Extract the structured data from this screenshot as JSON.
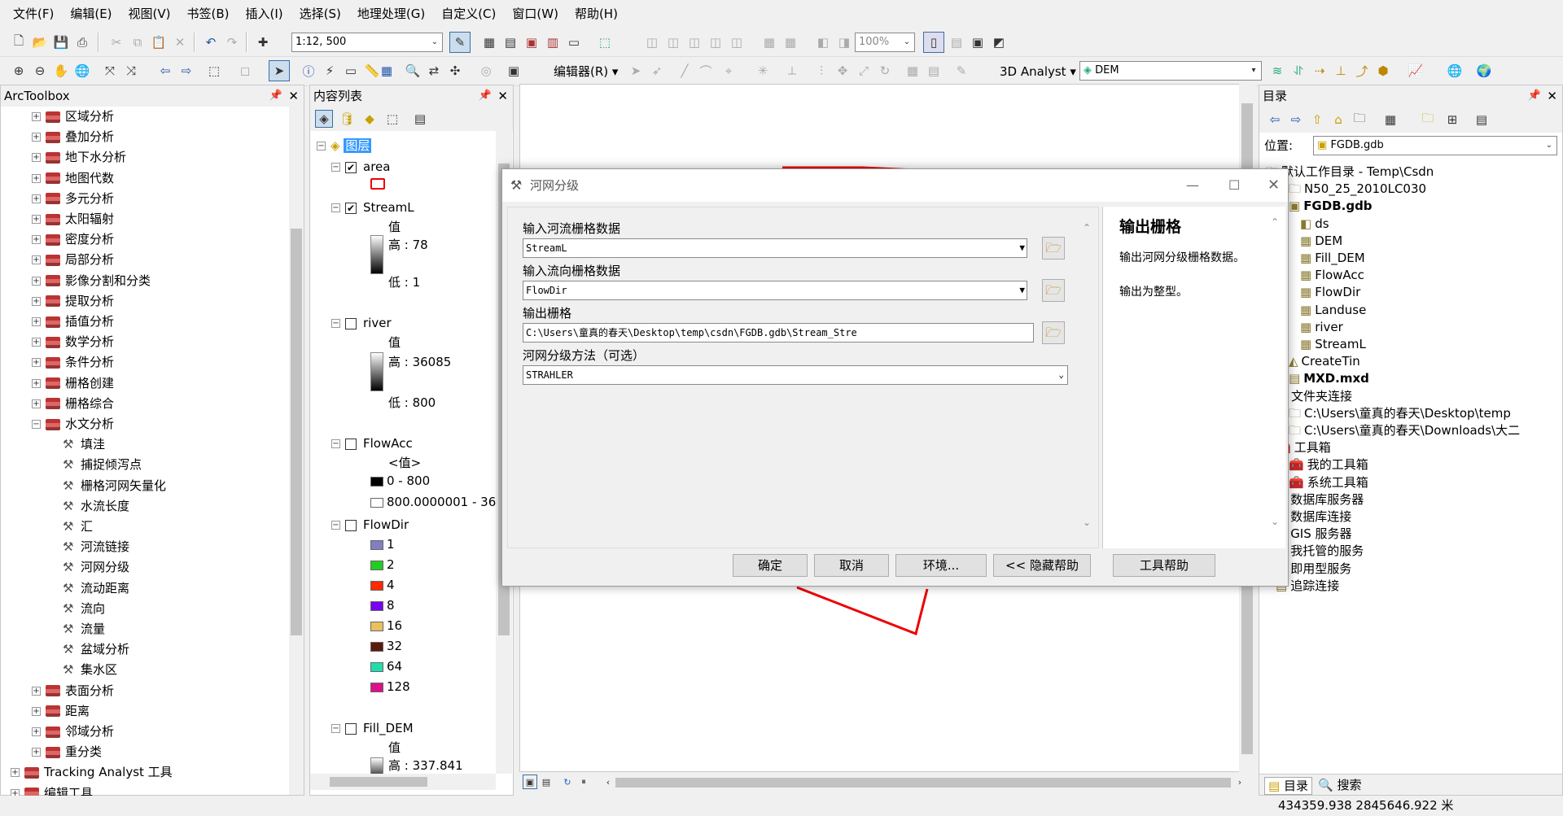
{
  "menu": [
    "文件(F)",
    "编辑(E)",
    "视图(V)",
    "书签(B)",
    "插入(I)",
    "选择(S)",
    "地理处理(G)",
    "自定义(C)",
    "窗口(W)",
    "帮助(H)"
  ],
  "toolbar": {
    "scale": "1:12, 500",
    "zoom_percent": "100%",
    "editor_label": "编辑器(R)",
    "analyst_label": "3D Analyst",
    "layer_value": "DEM"
  },
  "arctoolbox": {
    "title": "ArcToolbox",
    "items": [
      {
        "label": "区域分析",
        "type": "toolbox"
      },
      {
        "label": "叠加分析",
        "type": "toolbox"
      },
      {
        "label": "地下水分析",
        "type": "toolbox"
      },
      {
        "label": "地图代数",
        "type": "toolbox"
      },
      {
        "label": "多元分析",
        "type": "toolbox"
      },
      {
        "label": "太阳辐射",
        "type": "toolbox"
      },
      {
        "label": "密度分析",
        "type": "toolbox"
      },
      {
        "label": "局部分析",
        "type": "toolbox"
      },
      {
        "label": "影像分割和分类",
        "type": "toolbox"
      },
      {
        "label": "提取分析",
        "type": "toolbox"
      },
      {
        "label": "插值分析",
        "type": "toolbox"
      },
      {
        "label": "数学分析",
        "type": "toolbox"
      },
      {
        "label": "条件分析",
        "type": "toolbox"
      },
      {
        "label": "栅格创建",
        "type": "toolbox"
      },
      {
        "label": "栅格综合",
        "type": "toolbox"
      },
      {
        "label": "水文分析",
        "type": "toolbox-open"
      },
      {
        "label": "填洼",
        "type": "tool"
      },
      {
        "label": "捕捉倾泻点",
        "type": "tool"
      },
      {
        "label": "栅格河网矢量化",
        "type": "tool"
      },
      {
        "label": "水流长度",
        "type": "tool"
      },
      {
        "label": "汇",
        "type": "tool"
      },
      {
        "label": "河流链接",
        "type": "tool"
      },
      {
        "label": "河网分级",
        "type": "tool"
      },
      {
        "label": "流动距离",
        "type": "tool"
      },
      {
        "label": "流向",
        "type": "tool"
      },
      {
        "label": "流量",
        "type": "tool"
      },
      {
        "label": "盆域分析",
        "type": "tool"
      },
      {
        "label": "集水区",
        "type": "tool"
      },
      {
        "label": "表面分析",
        "type": "toolbox"
      },
      {
        "label": "距离",
        "type": "toolbox"
      },
      {
        "label": "邻域分析",
        "type": "toolbox"
      },
      {
        "label": "重分类",
        "type": "toolbox"
      },
      {
        "label": "Tracking Analyst 工具",
        "type": "root"
      },
      {
        "label": "编辑工具",
        "type": "root"
      }
    ]
  },
  "toc": {
    "title": "内容列表",
    "root": "图层",
    "value_label": "值",
    "val_label": "<值>",
    "area": {
      "name": "area"
    },
    "streaml": {
      "name": "StreamL",
      "high": "高 : 78",
      "low": "低 : 1"
    },
    "river": {
      "name": "river",
      "high": "高 : 36085",
      "low": "低 : 800"
    },
    "flowacc": {
      "name": "FlowAcc",
      "range1": "0 - 800",
      "range2": "800.0000001 - 36,"
    },
    "flowdir": {
      "name": "FlowDir",
      "classes": [
        {
          "label": "1",
          "color": "#8080c0"
        },
        {
          "label": "2",
          "color": "#22cc22"
        },
        {
          "label": "4",
          "color": "#ff2a00"
        },
        {
          "label": "8",
          "color": "#7700ee"
        },
        {
          "label": "16",
          "color": "#e8c060"
        },
        {
          "label": "32",
          "color": "#5a1a10"
        },
        {
          "label": "64",
          "color": "#22ddaa"
        },
        {
          "label": "128",
          "color": "#dd1188"
        }
      ]
    },
    "filldem": {
      "name": "Fill_DEM",
      "high": "高 : 337.841"
    }
  },
  "dialog": {
    "title": "河网分级",
    "in_stream_label": "输入河流栅格数据",
    "in_stream_value": "StreamL",
    "in_flowdir_label": "输入流向栅格数据",
    "in_flowdir_value": "FlowDir",
    "out_label": "输出栅格",
    "out_value": "C:\\Users\\童真的春天\\Desktop\\temp\\csdn\\FGDB.gdb\\Stream_Stre",
    "method_label": "河网分级方法（可选）",
    "method_value": "STRAHLER",
    "help_title": "输出栅格",
    "help_text1": "输出河网分级栅格数据。",
    "help_text2": "输出为整型。",
    "btn_ok": "确定",
    "btn_cancel": "取消",
    "btn_env": "环境...",
    "btn_hide": "<< 隐藏帮助",
    "btn_toolhelp": "工具帮助"
  },
  "catalog": {
    "title": "目录",
    "location_label": "位置:",
    "location_value": "FGDB.gdb",
    "items": [
      {
        "label": "默认工作目录 - Temp\\Csdn",
        "bold": false
      },
      {
        "label": "N50_25_2010LC030",
        "bold": false
      },
      {
        "label": "FGDB.gdb",
        "bold": true
      },
      {
        "label": "ds",
        "bold": false
      },
      {
        "label": "DEM",
        "bold": false
      },
      {
        "label": "Fill_DEM",
        "bold": false
      },
      {
        "label": "FlowAcc",
        "bold": false
      },
      {
        "label": "FlowDir",
        "bold": false
      },
      {
        "label": "Landuse",
        "bold": false
      },
      {
        "label": "river",
        "bold": false
      },
      {
        "label": "StreamL",
        "bold": false
      },
      {
        "label": "CreateTin",
        "bold": false
      },
      {
        "label": "MXD.mxd",
        "bold": true
      },
      {
        "label": "文件夹连接",
        "bold": false
      },
      {
        "label": "C:\\Users\\童真的春天\\Desktop\\temp",
        "bold": false
      },
      {
        "label": "C:\\Users\\童真的春天\\Downloads\\大二",
        "bold": false
      },
      {
        "label": "工具箱",
        "bold": false
      },
      {
        "label": "我的工具箱",
        "bold": false
      },
      {
        "label": "系统工具箱",
        "bold": false
      },
      {
        "label": "数据库服务器",
        "bold": false
      },
      {
        "label": "数据库连接",
        "bold": false
      },
      {
        "label": "GIS 服务器",
        "bold": false
      },
      {
        "label": "我托管的服务",
        "bold": false
      },
      {
        "label": "即用型服务",
        "bold": false
      },
      {
        "label": "追踪连接",
        "bold": false
      }
    ],
    "tab_catalog": "目录",
    "tab_search": "搜索"
  },
  "status": {
    "coords": "434359.938  2845646.922 米"
  }
}
